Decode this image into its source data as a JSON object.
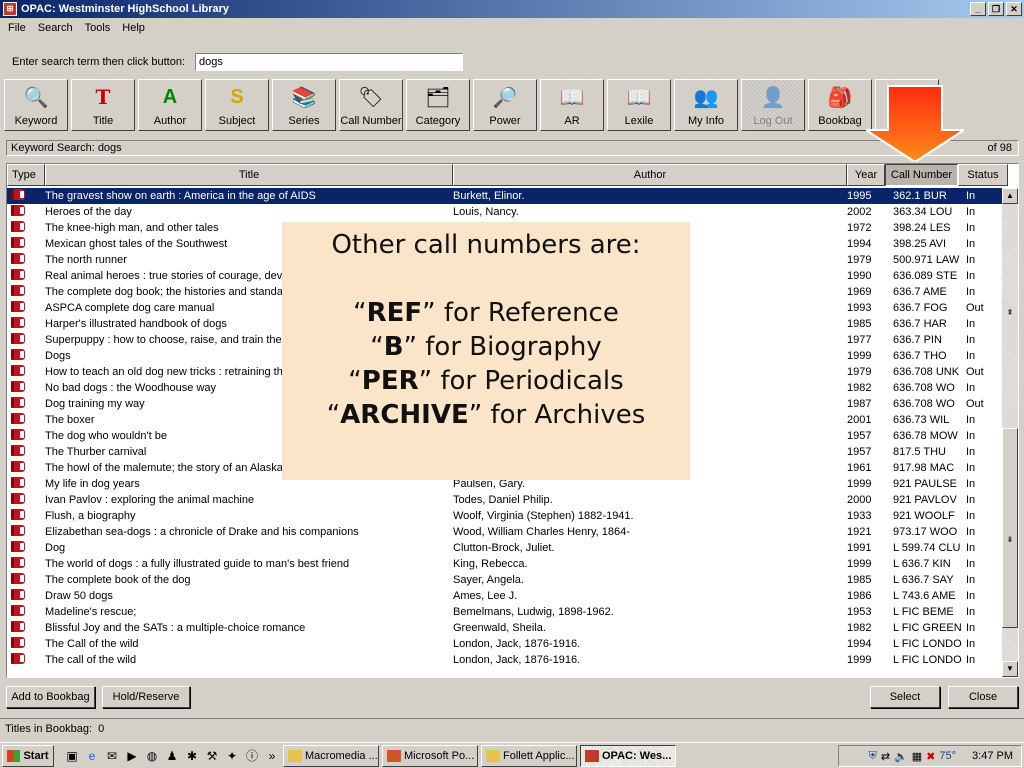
{
  "window": {
    "title": "OPAC: Westminster HighSchool Library",
    "min": "_",
    "max": "❐",
    "close": "✕"
  },
  "menu": [
    "File",
    "Search",
    "Tools",
    "Help"
  ],
  "search": {
    "label": "Enter search term then click button:",
    "value": "dogs"
  },
  "toolbar": [
    {
      "label": "Keyword",
      "icon": "🔍"
    },
    {
      "label": "Title",
      "icon": "T"
    },
    {
      "label": "Author",
      "icon": "A"
    },
    {
      "label": "Subject",
      "icon": "S"
    },
    {
      "label": "Series",
      "icon": "📚"
    },
    {
      "label": "Call Number",
      "icon": "🏷"
    },
    {
      "label": "Category",
      "icon": "🗂"
    },
    {
      "label": "Power",
      "icon": "🔎"
    },
    {
      "label": "AR",
      "icon": "📖"
    },
    {
      "label": "Lexile",
      "icon": "📖"
    },
    {
      "label": "My Info",
      "icon": "👥"
    },
    {
      "label": "Log Out",
      "icon": "👤"
    },
    {
      "label": "Bookbag",
      "icon": "🎒"
    },
    {
      "label": "",
      "icon": ""
    }
  ],
  "status": {
    "text": "Keyword Search: dogs",
    "count": "of 98"
  },
  "columns": [
    "Type",
    "Title",
    "Author",
    "Year",
    "Call Number",
    "Status"
  ],
  "rows": [
    {
      "title": "The gravest show on earth : America in the age of AIDS",
      "author": "Burkett, Elinor.",
      "year": "1995",
      "call": "362.1 BUR",
      "status": "In"
    },
    {
      "title": "Heroes of the day",
      "author": "Louis, Nancy.",
      "year": "2002",
      "call": "363.34 LOU",
      "status": "In"
    },
    {
      "title": "The knee-high man, and other tales",
      "author": "",
      "year": "1972",
      "call": "398.24 LES",
      "status": "In"
    },
    {
      "title": "Mexican ghost tales of the Southwest",
      "author": "",
      "year": "1994",
      "call": "398.25 AVI",
      "status": "In"
    },
    {
      "title": "The north runner",
      "author": "",
      "year": "1979",
      "call": "500.971 LAW",
      "status": "In"
    },
    {
      "title": "Real animal heroes : true stories of courage, devot",
      "author": "",
      "year": "1990",
      "call": "636.089 STE",
      "status": "In"
    },
    {
      "title": "The complete dog book; the histories and standard",
      "author": "",
      "year": "1969",
      "call": "636.7 AME",
      "status": "In"
    },
    {
      "title": "ASPCA complete dog care manual",
      "author": "",
      "year": "1993",
      "call": "636.7 FOG",
      "status": "Out"
    },
    {
      "title": "Harper's illustrated handbook of dogs",
      "author": "",
      "year": "1985",
      "call": "636.7 HAR",
      "status": "In"
    },
    {
      "title": "Superpuppy : how to choose, raise, and train the b",
      "author": "",
      "year": "1977",
      "call": "636.7 PIN",
      "status": "In"
    },
    {
      "title": "Dogs",
      "author": "",
      "year": "1999",
      "call": "636.7 THO",
      "status": "In"
    },
    {
      "title": "How to teach an old dog new tricks : retraining the",
      "author": "",
      "year": "1979",
      "call": "636.708 UNK",
      "status": "Out"
    },
    {
      "title": "No bad dogs : the Woodhouse way",
      "author": "",
      "year": "1982",
      "call": "636.708 WO",
      "status": "In"
    },
    {
      "title": "Dog training my way",
      "author": "",
      "year": "1987",
      "call": "636.708 WO",
      "status": "Out"
    },
    {
      "title": "The boxer",
      "author": "",
      "year": "2001",
      "call": "636.73 WIL",
      "status": "In"
    },
    {
      "title": "The dog who wouldn't be",
      "author": "",
      "year": "1957",
      "call": "636.78 MOW",
      "status": "In"
    },
    {
      "title": "The Thurber carnival",
      "author": "",
      "year": "1957",
      "call": "817.5 THU",
      "status": "In"
    },
    {
      "title": "The howl of the malemute; the story of an Alaskan",
      "author": "",
      "year": "1961",
      "call": "917.98 MAC",
      "status": "In"
    },
    {
      "title": "My life in dog years",
      "author": "Paulsen, Gary.",
      "year": "1999",
      "call": "921 PAULSE",
      "status": "In"
    },
    {
      "title": "Ivan Pavlov : exploring the animal machine",
      "author": "Todes, Daniel Philip.",
      "year": "2000",
      "call": "921 PAVLOV",
      "status": "In"
    },
    {
      "title": "Flush, a biography",
      "author": "Woolf, Virginia (Stephen) 1882-1941.",
      "year": "1933",
      "call": "921 WOOLF",
      "status": "In"
    },
    {
      "title": "Elizabethan sea-dogs : a chronicle of Drake and his companions",
      "author": "Wood, William Charles Henry, 1864-",
      "year": "1921",
      "call": "973.17 WOO",
      "status": "In"
    },
    {
      "title": "Dog",
      "author": "Clutton-Brock, Juliet.",
      "year": "1991",
      "call": "L 599.74 CLU",
      "status": "In"
    },
    {
      "title": "The world of dogs : a fully illustrated guide to man's best friend",
      "author": "King, Rebecca.",
      "year": "1999",
      "call": "L 636.7 KIN",
      "status": "In"
    },
    {
      "title": "The complete book of the dog",
      "author": "Sayer, Angela.",
      "year": "1985",
      "call": "L 636.7 SAY",
      "status": "In"
    },
    {
      "title": "Draw 50 dogs",
      "author": "Ames, Lee J.",
      "year": "1986",
      "call": "L 743.6 AME",
      "status": "In"
    },
    {
      "title": "Madeline's rescue;",
      "author": "Bemelmans, Ludwig, 1898-1962.",
      "year": "1953",
      "call": "L FIC  BEME",
      "status": "In"
    },
    {
      "title": "Blissful Joy and the SATs : a multiple-choice romance",
      "author": "Greenwald, Sheila.",
      "year": "1982",
      "call": "L FIC GREEN",
      "status": "In"
    },
    {
      "title": "The Call of the wild",
      "author": "London, Jack, 1876-1916.",
      "year": "1994",
      "call": "L FIC LONDO",
      "status": "In"
    },
    {
      "title": "The call of the wild",
      "author": "London, Jack, 1876-1916.",
      "year": "1999",
      "call": "L FIC LONDO",
      "status": "In"
    }
  ],
  "overlay": {
    "heading": "Other call numbers are:",
    "items": [
      {
        "code": "REF",
        "desc": " for Reference"
      },
      {
        "code": "B",
        "desc": " for Biography"
      },
      {
        "code": "PER",
        "desc": " for Periodicals"
      },
      {
        "code": "ARCHIVE",
        "desc": " for Archives"
      }
    ]
  },
  "buttons": {
    "add_to_bookbag": "Add to Bookbag",
    "hold_reserve": "Hold/Reserve",
    "select": "Select",
    "close": "Close"
  },
  "bookbag": {
    "label": "Titles in Bookbag:",
    "count": "0"
  },
  "taskbar": {
    "start": "Start",
    "tasks": [
      "Macromedia ...",
      "Microsoft Po...",
      "Follett Applic...",
      "OPAC: Wes..."
    ],
    "active_task": 3,
    "temperature": "75°",
    "time": "3:47 PM"
  },
  "colors": {
    "title_gradient_start": "#0a246a",
    "selection": "#0a246a",
    "overlay_bg": "#fbe5c8",
    "arrow": "#ff3a10"
  }
}
